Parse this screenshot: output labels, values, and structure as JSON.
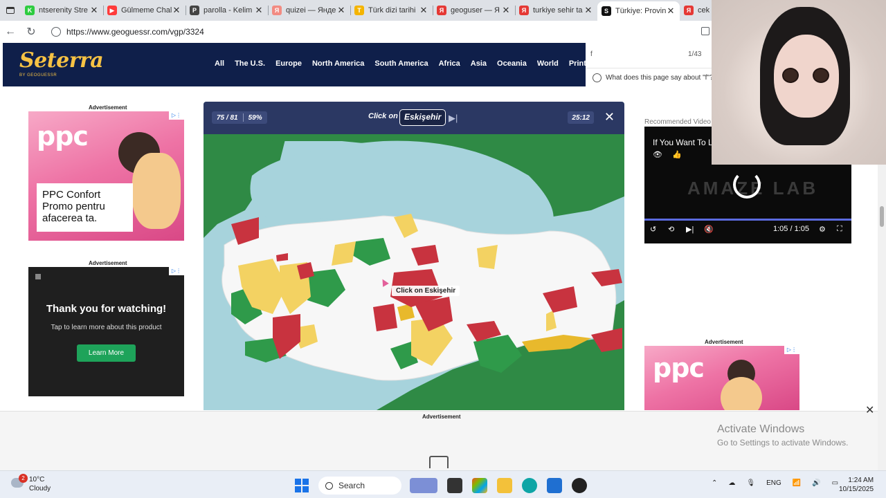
{
  "tabs": [
    {
      "title": "ntserenity Stre",
      "icon": "kick-favicon",
      "color": "#2ecc40",
      "letter": "K"
    },
    {
      "title": "Gülmeme Chal",
      "icon": "youtube-favicon",
      "color": "#ff3b3b",
      "letter": "▶"
    },
    {
      "title": "parolla - Kelim",
      "icon": "parolla-favicon",
      "color": "#444444",
      "letter": "P"
    },
    {
      "title": "quizei — Янде",
      "icon": "yandex-favicon",
      "color": "#f28b82",
      "letter": "Я"
    },
    {
      "title": "Türk dizi tarihi",
      "icon": "trivia-favicon",
      "color": "#f4b400",
      "letter": "T"
    },
    {
      "title": "geoguser — Я",
      "icon": "yandex-favicon",
      "color": "#e53935",
      "letter": "Я"
    },
    {
      "title": "turkiye sehir ta",
      "icon": "yandex-favicon",
      "color": "#e53935",
      "letter": "Я"
    },
    {
      "title": "Türkiye: Provin",
      "icon": "seterra-favicon",
      "color": "#111111",
      "letter": "S",
      "active": true
    },
    {
      "title": "cek b",
      "icon": "yandex-favicon",
      "color": "#e53935",
      "letter": "Я"
    }
  ],
  "address": {
    "url": "https://www.geoguessr.com/vgp/3324"
  },
  "site": {
    "logo": "Seterra",
    "logo_sub": "BY GEOGUESSR",
    "nav": [
      "All",
      "The U.S.",
      "Europe",
      "North America",
      "South America",
      "Africa",
      "Asia",
      "Oceania",
      "World",
      "Printables"
    ]
  },
  "findbar": {
    "query": "f",
    "count": "1/43"
  },
  "ask": {
    "text": "What does this page say about \"f\"?"
  },
  "ads": {
    "label": "Advertisement",
    "left_top": {
      "brand": "ppc",
      "line1": "PPC Confort",
      "line2": "Promo pentru",
      "line3": "afacerea ta."
    },
    "left_bottom": {
      "title": "Thank you for watching!",
      "subtitle": "Tap to learn more about this product",
      "button": "Learn More"
    },
    "right": {
      "brand": "ppc"
    }
  },
  "game": {
    "progress": "75 / 81",
    "percent": "59%",
    "prompt": "Click on",
    "target": "Eskişehir",
    "timer": "25:12",
    "tooltip": "Click on Eskişehir",
    "province_colors": {
      "correct": "#2f9a4a",
      "second_try": "#f3d262",
      "wrong": "#c8333f",
      "unplayed": "#f7f7f7",
      "sea": "#a7d3dc",
      "land_outside": "#2f8a45"
    }
  },
  "video": {
    "recommended_label": "Recommended Video",
    "title": "If You Want To L",
    "brand": "AMAZE LAB",
    "time": "1:05 / 1:05"
  },
  "windows": {
    "activate_title": "Activate Windows",
    "activate_sub": "Go to Settings to activate Windows."
  },
  "taskbar": {
    "temp": "10°C",
    "condition": "Cloudy",
    "weather_badge": "2",
    "search": "Search",
    "lang": "ENG",
    "time": "1:24 AM",
    "date": "10/15/2025"
  }
}
